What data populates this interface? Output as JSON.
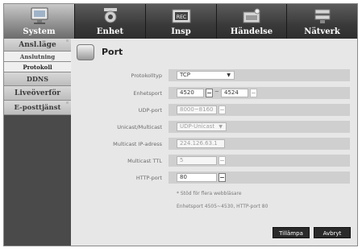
{
  "tabs": [
    {
      "label": "System",
      "icon": "system-icon",
      "active": true
    },
    {
      "label": "Enhet",
      "icon": "camera-icon",
      "active": false
    },
    {
      "label": "Insp",
      "icon": "recorder-icon",
      "active": false
    },
    {
      "label": "Händelse",
      "icon": "event-icon",
      "active": false
    },
    {
      "label": "Nätverk",
      "icon": "network-icon",
      "active": false
    }
  ],
  "sidebar": {
    "items": [
      {
        "label": "Ansl.läge"
      },
      {
        "label": "Anslutning"
      },
      {
        "label": "Protokoll"
      },
      {
        "label": "DDNS"
      },
      {
        "label": "Liveöverför"
      },
      {
        "label": "E-posttjänst"
      }
    ]
  },
  "page": {
    "title": "Port"
  },
  "form": {
    "protocol": {
      "label": "Protokolltyp",
      "value": "TCP"
    },
    "device_port": {
      "label": "Enhetsport",
      "from": "4520",
      "sep": "~",
      "to": "4524"
    },
    "udp_port": {
      "label": "UDP-port",
      "value": "8000~8160"
    },
    "unicast": {
      "label": "Unicast/Multicast",
      "value": "UDP-Unicast"
    },
    "multicast_ip": {
      "label": "Multicast IP-adress",
      "value": "224.126.63.1"
    },
    "multicast_ttl": {
      "label": "Multicast TTL",
      "value": "5"
    },
    "http_port": {
      "label": "HTTP-port",
      "value": "80"
    }
  },
  "notes": {
    "line1": "* Stöd för flera webbläsare",
    "line2": "Enhetsport 4505~4530, HTTP-port 80"
  },
  "buttons": {
    "apply": "Tillämpa",
    "cancel": "Avbryt"
  },
  "colors": {
    "active_tab": "#a9a9a9",
    "tab_bar": "#2b2b2b",
    "sidebar": "#4a4a4a",
    "content": "#e7e7e7",
    "button": "#2a2a2a"
  }
}
